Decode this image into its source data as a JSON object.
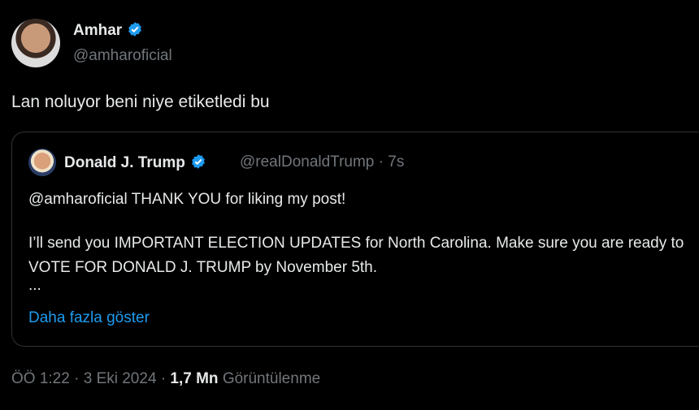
{
  "author": {
    "name": "Amhar",
    "handle": "@amharoficial",
    "verified_icon": "verified-badge-icon",
    "accent": "#1d9bf0"
  },
  "post_text": "Lan noluyor beni niye etiketledi bu",
  "quote": {
    "name": "Donald J. Trump",
    "handle": "@realDonaldTrump",
    "separator": "·",
    "time": "7s",
    "line1": "@amharoficial THANK YOU for liking my post!",
    "line2": "I’ll send you IMPORTANT ELECTION UPDATES for North Carolina. Make sure you are ready to VOTE FOR DONALD J. TRUMP by November 5th.",
    "ellipsis": "...",
    "show_more": "Daha fazla göster"
  },
  "footer": {
    "time": "ÖÖ 1:22",
    "sep1": "·",
    "date": "3 Eki 2024",
    "sep2": "·",
    "views_count": "1,7 Mn",
    "views_label": "Görüntülenme"
  }
}
